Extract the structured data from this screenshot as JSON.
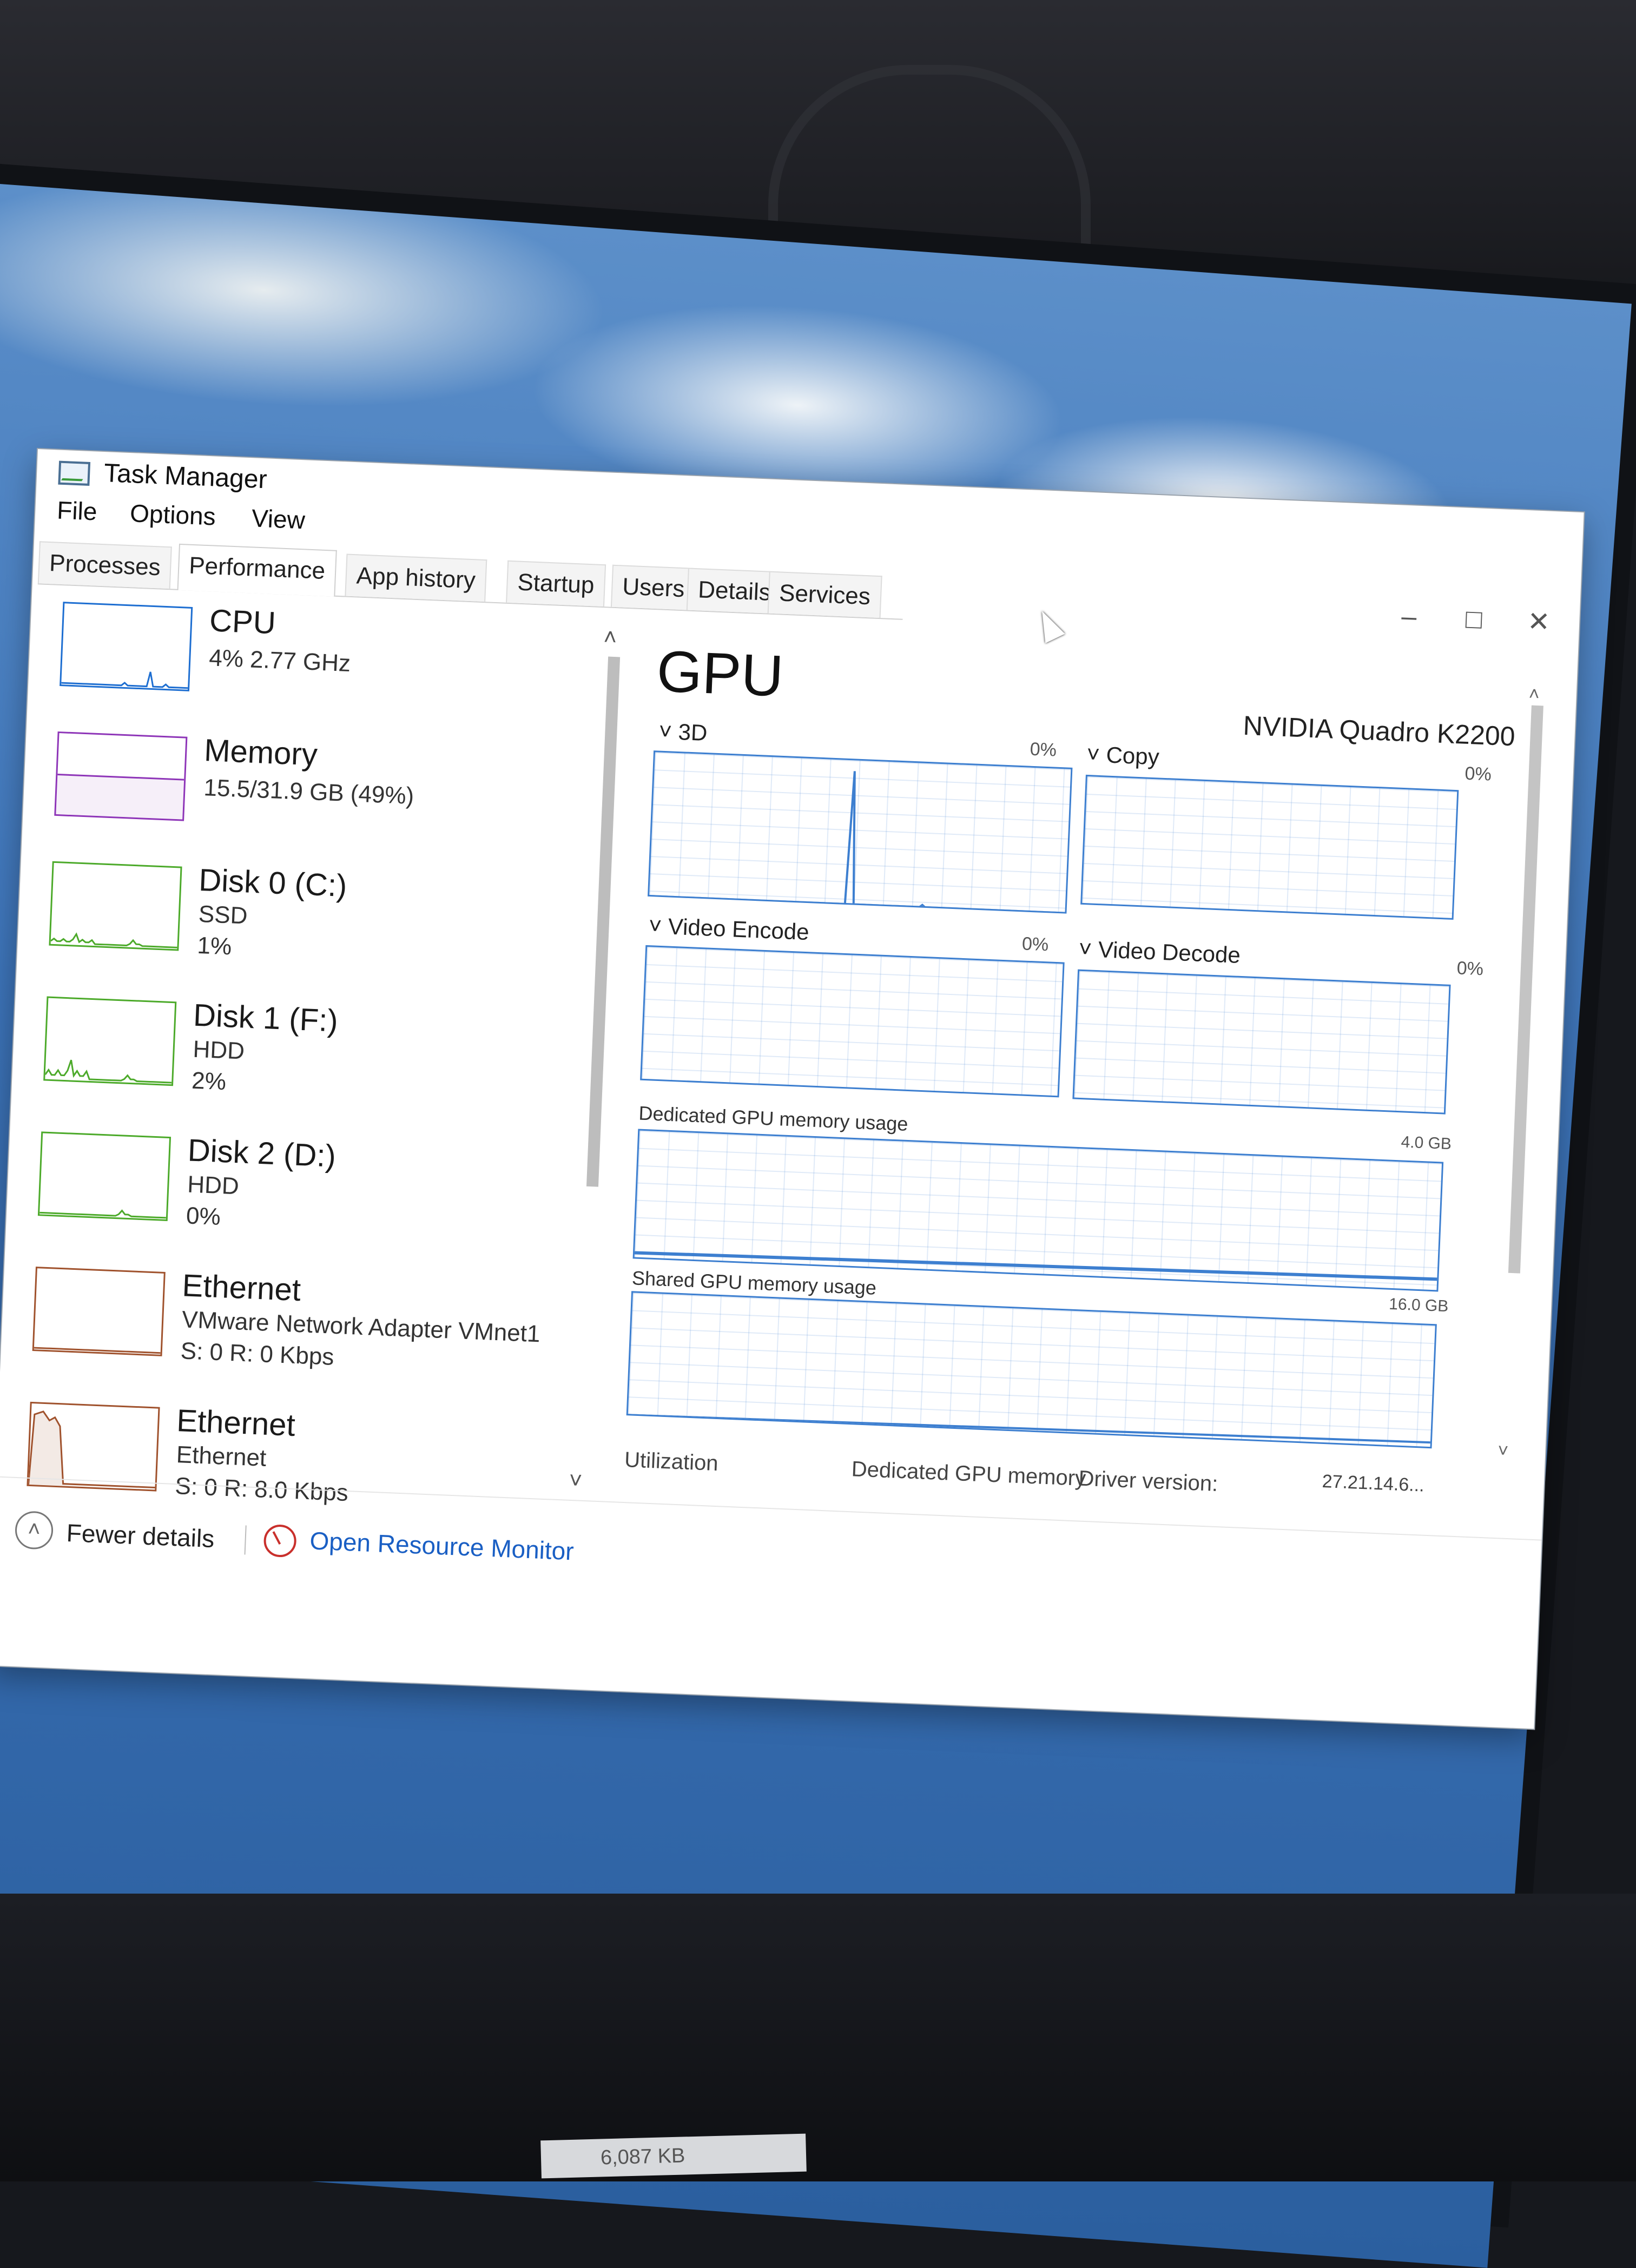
{
  "window": {
    "title": "Task Manager",
    "controls": {
      "minimize": "–",
      "maximize": "□",
      "close": "✕"
    }
  },
  "menu": [
    "File",
    "Options",
    "View"
  ],
  "tabs": [
    "Processes",
    "Performance",
    "App history",
    "Startup",
    "Users",
    "Details",
    "Services"
  ],
  "active_tab": "Performance",
  "resources": [
    {
      "name": "CPU",
      "sub1": "4% 2.77 GHz",
      "sub2": "",
      "sub3": "",
      "color": "#1d6ed1",
      "kind": "cpu",
      "utilization": 0.04
    },
    {
      "name": "Memory",
      "sub1": "15.5/31.9 GB (49%)",
      "sub2": "",
      "sub3": "",
      "color": "#8e35b8",
      "kind": "memory",
      "utilization": 0.49
    },
    {
      "name": "Disk 0 (C:)",
      "sub1": "SSD",
      "sub2": "1%",
      "sub3": "",
      "color": "#4caa2a",
      "kind": "disk",
      "utilization": 0.01
    },
    {
      "name": "Disk 1 (F:)",
      "sub1": "HDD",
      "sub2": "2%",
      "sub3": "",
      "color": "#4caa2a",
      "kind": "disk",
      "utilization": 0.02
    },
    {
      "name": "Disk 2 (D:)",
      "sub1": "HDD",
      "sub2": "0%",
      "sub3": "",
      "color": "#4caa2a",
      "kind": "disk",
      "utilization": 0.0
    },
    {
      "name": "Ethernet",
      "sub1": "VMware Network Adapter VMnet1",
      "sub2": "S: 0 R: 0 Kbps",
      "sub3": "",
      "color": "#a0522d",
      "kind": "ethernet",
      "utilization": 0.0
    },
    {
      "name": "Ethernet",
      "sub1": "Ethernet",
      "sub2": "S: 0 R: 8.0 Kbps",
      "sub3": "",
      "color": "#a0522d",
      "kind": "ethernet",
      "utilization": 0.01
    }
  ],
  "gpu": {
    "title": "GPU",
    "model": "NVIDIA Quadro K2200",
    "engines": [
      {
        "label": "3D",
        "pct": "0%"
      },
      {
        "label": "Copy",
        "pct": "0%"
      },
      {
        "label": "Video Encode",
        "pct": "0%"
      },
      {
        "label": "Video Decode",
        "pct": "0%"
      }
    ],
    "dedicated_label": "Dedicated GPU memory usage",
    "dedicated_capacity": "4.0 GB",
    "shared_label": "Shared GPU memory usage",
    "shared_capacity": "16.0 GB",
    "footer": {
      "utilization": "Utilization",
      "dedicated": "Dedicated GPU memory",
      "driver_version_label": "Driver version:",
      "driver_version_value": "27.21.14.6..."
    }
  },
  "bottom": {
    "fewer_details": "Fewer details",
    "open_resource_monitor": "Open Resource Monitor"
  },
  "taskbar_fragment": "6,087 KB",
  "colors": {
    "accent_blue": "#3d7fd0",
    "link_blue": "#1a5fc4"
  }
}
